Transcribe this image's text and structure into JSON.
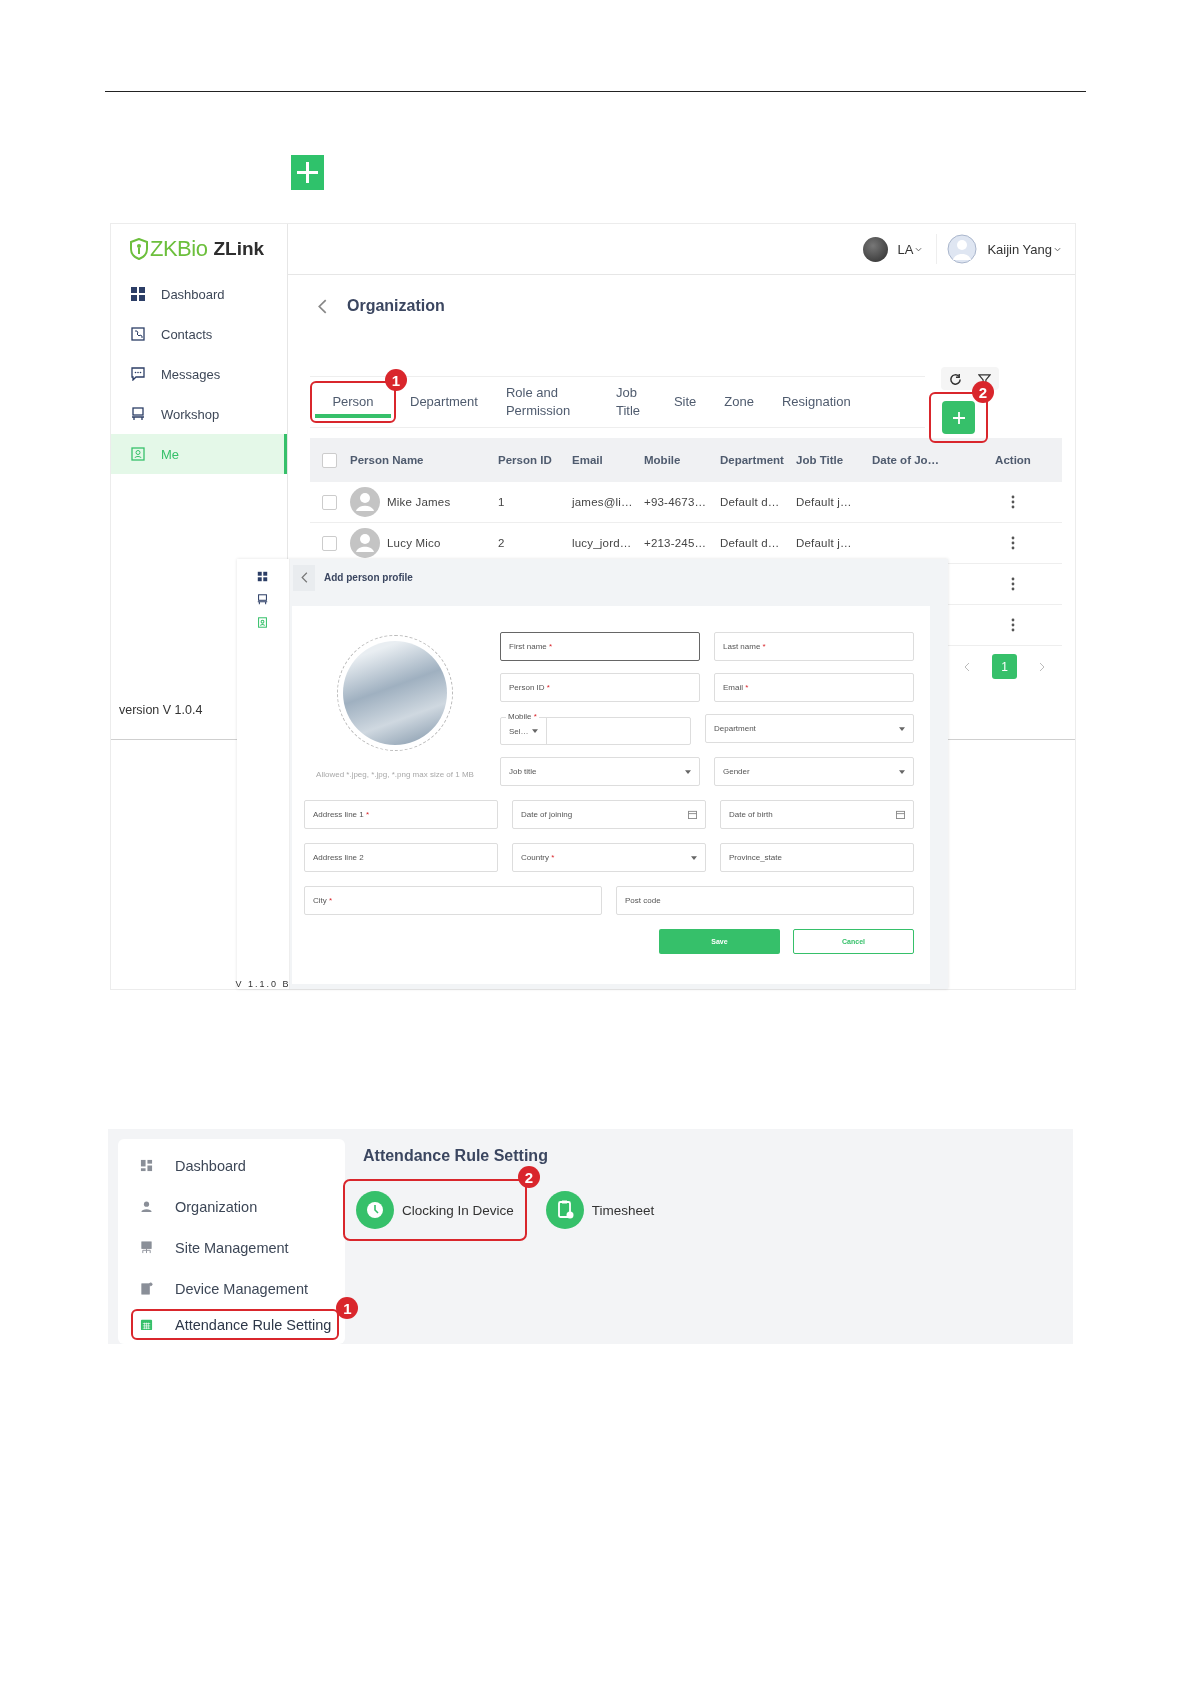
{
  "app": {
    "logo": {
      "brand": "ZKBio",
      "product": "ZLink"
    },
    "sidebar": {
      "items": [
        {
          "label": "Dashboard",
          "selected": false
        },
        {
          "label": "Contacts",
          "selected": false
        },
        {
          "label": "Messages",
          "selected": false
        },
        {
          "label": "Workshop",
          "selected": false
        },
        {
          "label": "Me",
          "selected": true
        }
      ],
      "version": "version V 1.0.4"
    },
    "header": {
      "language": "LA",
      "user": "Kaijin Yang"
    },
    "page_title": "Organization",
    "tabs": [
      {
        "label": "Person",
        "selected": true,
        "callout": "1"
      },
      {
        "label": "Department",
        "selected": false
      },
      {
        "label": "Role and Permission",
        "selected": false
      },
      {
        "label": "Job Title",
        "selected": false
      },
      {
        "label": "Site",
        "selected": false
      },
      {
        "label": "Zone",
        "selected": false
      },
      {
        "label": "Resignation",
        "selected": false
      }
    ],
    "add_button": {
      "callout": "2"
    },
    "table": {
      "all_checked": false,
      "columns": [
        "Person Name",
        "Person ID",
        "Email",
        "Mobile",
        "Department",
        "Job Title",
        "Date of Jo…",
        "Action"
      ],
      "rows": [
        {
          "checked": false,
          "cells": [
            "Mike James",
            "1",
            "james@li…",
            "+93-4673…",
            "Default d…",
            "Default j…"
          ]
        },
        {
          "checked": false,
          "cells": [
            "Lucy Mico",
            "2",
            "lucy_jord…",
            "+213-245…",
            "Default d…",
            "Default j…"
          ]
        },
        {},
        {}
      ]
    },
    "pagination": {
      "pages": [
        {
          "label": "1",
          "selected": true
        }
      ]
    }
  },
  "dialog": {
    "nav": [
      {
        "selected": false
      },
      {
        "selected": false
      },
      {
        "selected": true
      }
    ],
    "version": "V 1.1.0 B",
    "title": "Add person profile",
    "photo_hint": "Allowed *.jpeg, *.jpg, *.png max size of 1 MB",
    "fields_beside_photo": [
      [
        {
          "kind": "text",
          "placeholder": "First name",
          "marker": "*",
          "focused": true
        },
        {
          "kind": "text",
          "placeholder": "Last name",
          "marker": "*",
          "focused": false
        }
      ],
      [
        {
          "kind": "text",
          "placeholder": "Person ID",
          "marker": "*",
          "focused": false
        },
        {
          "kind": "text",
          "placeholder": "Email",
          "marker": "*",
          "focused": false
        }
      ],
      [
        {
          "kind": "phone",
          "label": "Mobile",
          "marker": "*",
          "code": "Sel…",
          "focused": false
        },
        {
          "kind": "select",
          "placeholder": "Department",
          "focused": false
        }
      ],
      [
        {
          "kind": "select",
          "placeholder": "Job title",
          "focused": false
        },
        {
          "kind": "select",
          "placeholder": "Gender",
          "focused": false
        }
      ]
    ],
    "fields": [
      [
        {
          "kind": "text",
          "placeholder": "Address line 1",
          "marker": "*",
          "focused": false
        },
        {
          "kind": "date",
          "placeholder": "Date of joining",
          "focused": false
        },
        {
          "kind": "date",
          "placeholder": "Date of birth",
          "focused": false
        }
      ],
      [
        {
          "kind": "text",
          "placeholder": "Address line 2",
          "focused": false
        },
        {
          "kind": "select",
          "placeholder": "Country",
          "marker": "*",
          "focused": false
        },
        {
          "kind": "text",
          "placeholder": "Province_state",
          "focused": false
        }
      ],
      [
        {
          "kind": "text",
          "placeholder": "City",
          "marker": "*",
          "focused": false
        },
        {
          "kind": "text",
          "placeholder": "Post code",
          "focused": false
        }
      ]
    ],
    "buttons": [
      {
        "kind": "primary",
        "label": "Save"
      },
      {
        "kind": "secondary",
        "label": "Cancel"
      }
    ]
  },
  "attendance": {
    "sidebar": [
      {
        "label": "Dashboard",
        "selected": false
      },
      {
        "label": "Organization",
        "selected": false
      },
      {
        "label": "Site Management",
        "selected": false
      },
      {
        "label": "Device Management",
        "selected": false
      },
      {
        "label": "Attendance Rule Setting",
        "selected": true,
        "callout": "1"
      }
    ],
    "title": "Attendance Rule Setting",
    "cards": [
      {
        "label": "Clocking In Device",
        "callout": "2"
      },
      {
        "label": "Timesheet"
      }
    ]
  }
}
